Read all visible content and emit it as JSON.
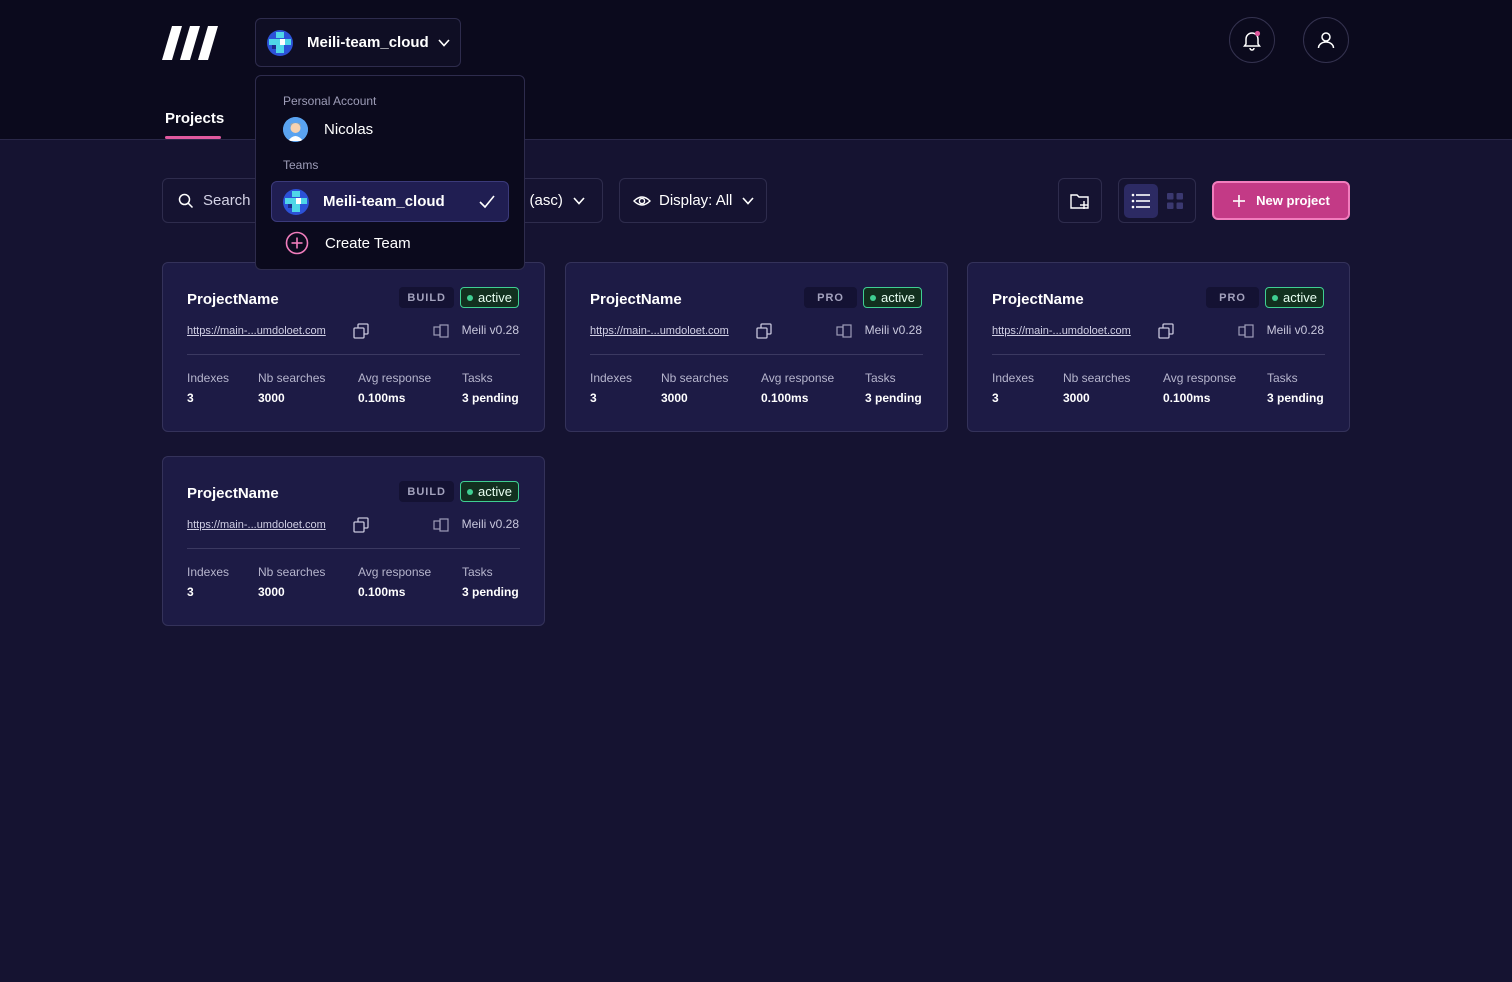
{
  "header": {
    "team_selected": "Meili-team_cloud",
    "tabs": [
      {
        "label": "Projects",
        "active": true
      }
    ]
  },
  "toolbar": {
    "search_placeholder": "Search",
    "sort_label": "e (asc)",
    "display_label": "Display: All",
    "new_project_label": "New project",
    "view_mode": "list"
  },
  "dropdown": {
    "personal_section": "Personal Account",
    "personal_name": "Nicolas",
    "teams_section": "Teams",
    "teams": [
      {
        "name": "Meili-team_cloud",
        "selected": true
      }
    ],
    "create_label": "Create Team"
  },
  "stat_labels": {
    "indexes": "Indexes",
    "searches": "Nb searches",
    "avg": "Avg response",
    "tasks": "Tasks"
  },
  "projects": [
    {
      "name": "ProjectName",
      "plan": "BUILD",
      "status": "active",
      "url": "https://main-...umdoloet.com",
      "version": "Meili v0.28",
      "indexes": "3",
      "searches": "3000",
      "avg": "0.100ms",
      "tasks": "3 pending"
    },
    {
      "name": "ProjectName",
      "plan": "PRO",
      "status": "active",
      "url": "https://main-...umdoloet.com",
      "version": "Meili v0.28",
      "indexes": "3",
      "searches": "3000",
      "avg": "0.100ms",
      "tasks": "3 pending"
    },
    {
      "name": "ProjectName",
      "plan": "PRO",
      "status": "active",
      "url": "https://main-...umdoloet.com",
      "version": "Meili v0.28",
      "indexes": "3",
      "searches": "3000",
      "avg": "0.100ms",
      "tasks": "3 pending"
    },
    {
      "name": "ProjectName",
      "plan": "BUILD",
      "status": "active",
      "url": "https://main-...umdoloet.com",
      "version": "Meili v0.28",
      "indexes": "3",
      "searches": "3000",
      "avg": "0.100ms",
      "tasks": "3 pending"
    }
  ],
  "colors": {
    "accent": "#e0599e",
    "active": "#3fcf92",
    "background": "#151331",
    "header": "#0b0a1d"
  },
  "icons": {
    "logo": "meili-logo-icon",
    "bell": "bell-icon",
    "user": "user-icon",
    "search": "search-icon",
    "eye": "eye-icon",
    "folder": "folder-plus-icon",
    "list": "list-view-icon",
    "grid": "grid-view-icon",
    "plus": "plus-icon",
    "copy": "copy-icon",
    "check": "check-icon"
  }
}
